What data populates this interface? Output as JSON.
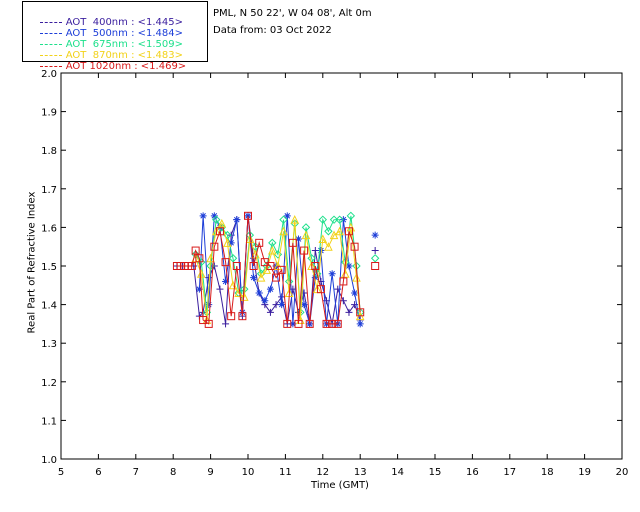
{
  "header": {
    "site": "PML, N 50 22', W 04 08', Alt 0m",
    "date": "Data from: 03 Oct 2022"
  },
  "legend": [
    {
      "label": "AOT  400nm : <1.445>",
      "color": "#3a1e9e"
    },
    {
      "label": "AOT  500nm : <1.484>",
      "color": "#1d3ed8"
    },
    {
      "label": "AOT  675nm : <1.509>",
      "color": "#1ee08c"
    },
    {
      "label": "AOT  870nm : <1.483>",
      "color": "#f2d21a"
    },
    {
      "label": "AOT 1020nm : <1.469>",
      "color": "#d81a1a"
    }
  ],
  "chart_data": {
    "type": "line",
    "xlabel": "Time (GMT)",
    "ylabel": "Real Part of Refractive Index",
    "xlim": [
      5,
      20
    ],
    "ylim": [
      1.0,
      2.0
    ],
    "xticks": [
      5,
      6,
      7,
      8,
      9,
      10,
      11,
      12,
      13,
      14,
      15,
      16,
      17,
      18,
      19,
      20
    ],
    "yticks": [
      1.0,
      1.1,
      1.2,
      1.3,
      1.4,
      1.5,
      1.6,
      1.7,
      1.8,
      1.9,
      2.0
    ],
    "series": [
      {
        "name": "AOT  400nm",
        "color": "#3a1e9e",
        "marker": "plus",
        "x": [
          8.1,
          8.25,
          8.4,
          8.55,
          8.7,
          8.8,
          8.95,
          9.1,
          9.25,
          9.4,
          9.55,
          9.7,
          9.85,
          10.0,
          10.15,
          10.3,
          10.45,
          10.6,
          10.75,
          10.9,
          11.05,
          11.2,
          11.35,
          11.5,
          11.65,
          11.8,
          11.95,
          12.1,
          12.25,
          12.4,
          12.55,
          12.7,
          12.85,
          13.0
        ],
        "y": [
          1.5,
          1.5,
          1.5,
          1.5,
          1.37,
          1.38,
          1.47,
          1.5,
          1.44,
          1.35,
          1.58,
          1.62,
          1.37,
          1.63,
          1.52,
          1.43,
          1.4,
          1.38,
          1.4,
          1.42,
          1.35,
          1.44,
          1.38,
          1.43,
          1.35,
          1.54,
          1.46,
          1.41,
          1.35,
          1.44,
          1.41,
          1.38,
          1.4,
          1.36
        ]
      },
      {
        "name": "AOT  500nm",
        "color": "#1d3ed8",
        "marker": "asterisk",
        "x": [
          8.7,
          8.8,
          8.95,
          9.1,
          9.25,
          9.4,
          9.55,
          9.7,
          9.85,
          10.0,
          10.15,
          10.3,
          10.45,
          10.6,
          10.75,
          10.9,
          11.05,
          11.2,
          11.35,
          11.5,
          11.65,
          11.8,
          11.95,
          12.1,
          12.25,
          12.4,
          12.55,
          12.7,
          12.85,
          13.0
        ],
        "y": [
          1.44,
          1.63,
          1.4,
          1.63,
          1.6,
          1.46,
          1.56,
          1.62,
          1.38,
          1.63,
          1.47,
          1.43,
          1.41,
          1.44,
          1.5,
          1.4,
          1.63,
          1.35,
          1.57,
          1.4,
          1.35,
          1.47,
          1.54,
          1.35,
          1.48,
          1.35,
          1.62,
          1.5,
          1.43,
          1.35
        ]
      },
      {
        "name": "AOT  675nm",
        "color": "#1ee08c",
        "marker": "diamond",
        "x": [
          8.6,
          8.75,
          8.9,
          9.0,
          9.15,
          9.3,
          9.45,
          9.6,
          9.75,
          9.9,
          10.05,
          10.2,
          10.35,
          10.5,
          10.65,
          10.8,
          10.95,
          11.1,
          11.25,
          11.4,
          11.55,
          11.7,
          11.85,
          12.0,
          12.15,
          12.3,
          12.45,
          12.6,
          12.75,
          12.9,
          13.0
        ],
        "y": [
          1.53,
          1.51,
          1.38,
          1.5,
          1.62,
          1.6,
          1.58,
          1.52,
          1.43,
          1.44,
          1.58,
          1.55,
          1.48,
          1.5,
          1.56,
          1.53,
          1.62,
          1.46,
          1.61,
          1.38,
          1.6,
          1.52,
          1.48,
          1.62,
          1.59,
          1.62,
          1.62,
          1.51,
          1.63,
          1.5,
          1.38
        ]
      },
      {
        "name": "AOT  870nm",
        "color": "#f2d21a",
        "marker": "triangle",
        "x": [
          8.6,
          8.75,
          8.9,
          9.0,
          9.15,
          9.3,
          9.45,
          9.6,
          9.75,
          9.9,
          10.05,
          10.2,
          10.35,
          10.5,
          10.65,
          10.8,
          10.95,
          11.1,
          11.25,
          11.4,
          11.55,
          11.7,
          11.85,
          12.0,
          12.15,
          12.3,
          12.45,
          12.6,
          12.75,
          12.9,
          13.0
        ],
        "y": [
          1.52,
          1.48,
          1.36,
          1.52,
          1.59,
          1.61,
          1.56,
          1.45,
          1.43,
          1.42,
          1.57,
          1.53,
          1.47,
          1.49,
          1.54,
          1.5,
          1.59,
          1.43,
          1.62,
          1.36,
          1.58,
          1.5,
          1.44,
          1.57,
          1.55,
          1.58,
          1.59,
          1.48,
          1.6,
          1.47,
          1.37
        ]
      },
      {
        "name": "AOT 1020nm",
        "color": "#d81a1a",
        "marker": "square",
        "x": [
          8.1,
          8.2,
          8.3,
          8.4,
          8.5,
          8.6,
          8.7,
          8.8,
          8.95,
          9.1,
          9.25,
          9.4,
          9.55,
          9.7,
          9.85,
          10.0,
          10.15,
          10.3,
          10.45,
          10.6,
          10.75,
          10.9,
          11.05,
          11.2,
          11.35,
          11.5,
          11.65,
          11.8,
          11.95,
          12.1,
          12.25,
          12.4,
          12.55,
          12.7,
          12.85,
          13.0
        ],
        "y": [
          1.5,
          1.5,
          1.5,
          1.5,
          1.5,
          1.54,
          1.52,
          1.36,
          1.35,
          1.55,
          1.59,
          1.51,
          1.37,
          1.5,
          1.37,
          1.63,
          1.5,
          1.56,
          1.51,
          1.5,
          1.47,
          1.49,
          1.35,
          1.56,
          1.35,
          1.54,
          1.35,
          1.5,
          1.44,
          1.35,
          1.35,
          1.35,
          1.46,
          1.59,
          1.55,
          1.38
        ]
      }
    ],
    "outliers": [
      {
        "series": "AOT  500nm",
        "x": 13.4,
        "y": 1.58
      },
      {
        "series": "AOT  400nm",
        "x": 13.4,
        "y": 1.54
      },
      {
        "series": "AOT  675nm",
        "x": 13.4,
        "y": 1.52
      },
      {
        "series": "AOT 1020nm",
        "x": 13.4,
        "y": 1.5
      }
    ]
  }
}
